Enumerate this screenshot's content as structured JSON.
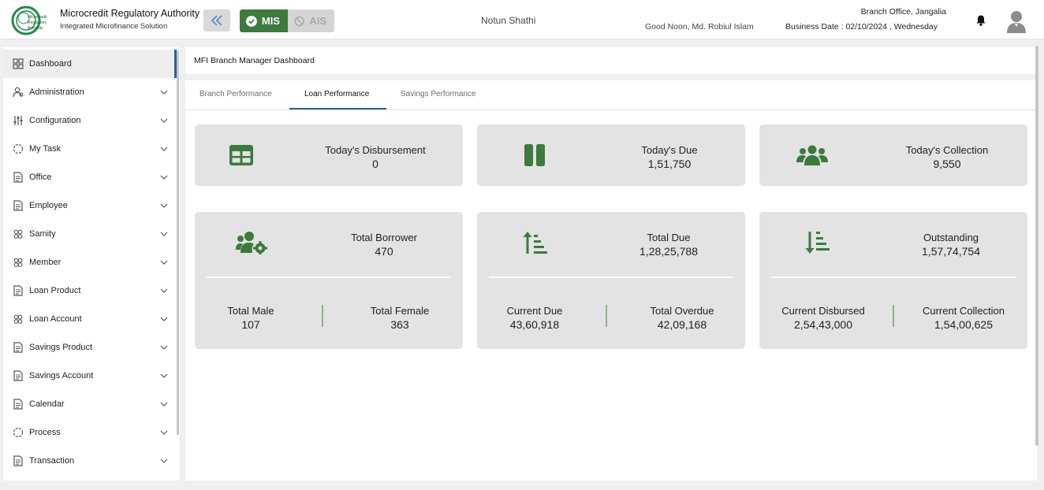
{
  "header": {
    "brand_title": "Microcredit Regulatory Authority",
    "brand_subtitle": "Integrated Microfinance Solution",
    "logo_text": "Microcredit Regulatory Authority",
    "mode_mis": "MIS",
    "mode_ais": "AIS",
    "org_name": "Notun Shathi",
    "greeting": "Good Noon, Md. Robiul Islam",
    "branch": "Branch Office, Jangalia",
    "business_date": "Business Date : 02/10/2024 , Wednesday"
  },
  "sidebar": {
    "items": [
      {
        "label": "Dashboard",
        "icon": "dashboard-grid-icon",
        "active": true
      },
      {
        "label": "Administration",
        "icon": "admin-users-icon"
      },
      {
        "label": "Configuration",
        "icon": "sliders-icon"
      },
      {
        "label": "My Task",
        "icon": "circle-dashed-icon"
      },
      {
        "label": "Office",
        "icon": "document-icon"
      },
      {
        "label": "Employee",
        "icon": "document-icon"
      },
      {
        "label": "Samity",
        "icon": "group-icon"
      },
      {
        "label": "Member",
        "icon": "group-icon"
      },
      {
        "label": "Loan Product",
        "icon": "document-icon"
      },
      {
        "label": "Loan Account",
        "icon": "group-icon"
      },
      {
        "label": "Savings Product",
        "icon": "document-icon"
      },
      {
        "label": "Savings Account",
        "icon": "document-icon"
      },
      {
        "label": "Calendar",
        "icon": "document-icon"
      },
      {
        "label": "Process",
        "icon": "circle-dashed-icon"
      },
      {
        "label": "Transaction",
        "icon": "document-icon"
      }
    ]
  },
  "main": {
    "title": "MFI Branch Manager Dashboard",
    "tabs": [
      {
        "label": "Branch Performance"
      },
      {
        "label": "Loan Performance",
        "active": true
      },
      {
        "label": "Savings Performance"
      }
    ],
    "cards_top": [
      {
        "label": "Today's Disbursement",
        "value": "0",
        "icon": "table-grid-icon"
      },
      {
        "label": "Today's Due",
        "value": "1,51,750",
        "icon": "pause-icon"
      },
      {
        "label": "Today's Collection",
        "value": "9,550",
        "icon": "users-icon"
      }
    ],
    "cards_bottom": [
      {
        "label": "Total Borrower",
        "value": "470",
        "icon": "users-gear-icon",
        "left_label": "Total Male",
        "left_value": "107",
        "right_label": "Total Female",
        "right_value": "363"
      },
      {
        "label": "Total Due",
        "value": "1,28,25,788",
        "icon": "sort-up-icon",
        "left_label": "Current Due",
        "left_value": "43,60,918",
        "right_label": "Total Overdue",
        "right_value": "42,09,168"
      },
      {
        "label": "Outstanding",
        "value": "1,57,74,754",
        "icon": "sort-down-icon",
        "left_label": "Current Disbursed",
        "left_value": "2,54,43,000",
        "right_label": "Current Collection",
        "right_value": "1,54,00,625"
      }
    ]
  },
  "colors": {
    "accent_green": "#3c7a3e",
    "tab_accent": "#2d5f9b",
    "card_bg": "#e2e3e2"
  }
}
